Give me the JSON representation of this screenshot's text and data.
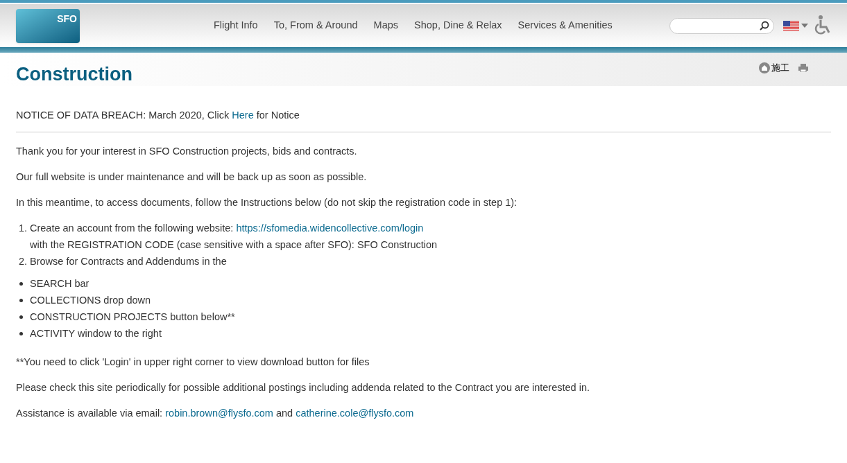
{
  "header": {
    "logo_text": "SFO",
    "nav": [
      "Flight Info",
      "To, From & Around",
      "Maps",
      "Shop, Dine & Relax",
      "Services & Amenities"
    ]
  },
  "breadcrumb": "施工",
  "title": "Construction",
  "notice": [
    {
      "text": "NOTICE OF DATA BREACH: March 2020, Click "
    },
    {
      "text": "Here",
      "link": true
    },
    {
      "text": " for Notice"
    }
  ],
  "intro": [
    [
      {
        "text": "Thank you for your interest in SFO Construction projects, bids and contracts."
      }
    ],
    [
      {
        "text": "Our full website is under maintenance and will be back up as soon as possible."
      }
    ],
    [
      {
        "text": "In this meantime, to access documents, follow the Instructions below (do not skip the registration code in step 1):"
      }
    ]
  ],
  "steps": [
    {
      "number": "1.",
      "lines": [
        [
          {
            "text": "Create an account from the following website: "
          },
          {
            "text": "https://sfomedia.widencollective.com/login",
            "link": true
          }
        ],
        [
          {
            "text": "with the REGISTRATION CODE (case sensitive with a space after SFO): SFO Construction"
          }
        ]
      ]
    },
    {
      "number": "2.",
      "lines": [
        [
          {
            "text": "Browse for Contracts and Addendums in the"
          }
        ]
      ],
      "bullets": [
        "SEARCH bar",
        "COLLECTIONS drop down",
        "CONSTRUCTION PROJECTS button below**",
        "ACTIVITY window to the right"
      ]
    }
  ],
  "outro": [
    [
      {
        "text": "**You need to click 'Login' in upper right corner to view download button for files"
      }
    ],
    [
      {
        "text": "Please check this site periodically for possible additional postings including addenda related to the Contract you are interested in."
      }
    ],
    [
      {
        "text": "Assistance is available via email: "
      },
      {
        "text": "robin.brown@flysfo.com",
        "link": true
      },
      {
        "text": " and "
      },
      {
        "text": "catherine.cole@flysfo.com",
        "link": true
      }
    ]
  ]
}
